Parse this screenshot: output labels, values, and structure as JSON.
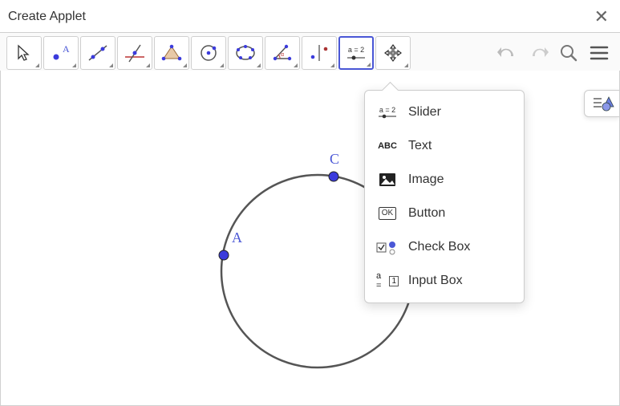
{
  "window": {
    "title": "Create Applet"
  },
  "toolbar": {
    "tools": [
      {
        "id": "move",
        "name": "move-tool"
      },
      {
        "id": "point",
        "name": "point-tool"
      },
      {
        "id": "line",
        "name": "line-tool"
      },
      {
        "id": "perpendicular",
        "name": "perpendicular-line-tool"
      },
      {
        "id": "polygon",
        "name": "polygon-tool"
      },
      {
        "id": "circle",
        "name": "circle-tool"
      },
      {
        "id": "ellipse",
        "name": "ellipse-conic-tool"
      },
      {
        "id": "angle",
        "name": "angle-tool"
      },
      {
        "id": "reflect",
        "name": "reflect-tool"
      },
      {
        "id": "slider",
        "name": "slider-tool",
        "selected": true,
        "badge": "a = 2"
      },
      {
        "id": "movegraphics",
        "name": "move-graphics-tool"
      }
    ],
    "controls": {
      "undo": "undo",
      "redo": "redo",
      "search": "search",
      "menu": "menu"
    }
  },
  "dropdown": {
    "items": [
      {
        "label": "Slider",
        "icon": "slider-icon",
        "badge": "a = 2"
      },
      {
        "label": "Text",
        "icon": "text-icon",
        "badge": "ABC"
      },
      {
        "label": "Image",
        "icon": "image-icon"
      },
      {
        "label": "Button",
        "icon": "button-icon",
        "badge": "OK"
      },
      {
        "label": "Check Box",
        "icon": "checkbox-icon"
      },
      {
        "label": "Input Box",
        "icon": "inputbox-icon",
        "badge": "a = 1"
      }
    ]
  },
  "canvas": {
    "points": {
      "A": "A",
      "C": "C"
    }
  },
  "colors": {
    "accent": "#4a57d6",
    "point": "#3b3bdc",
    "stroke": "#555"
  }
}
